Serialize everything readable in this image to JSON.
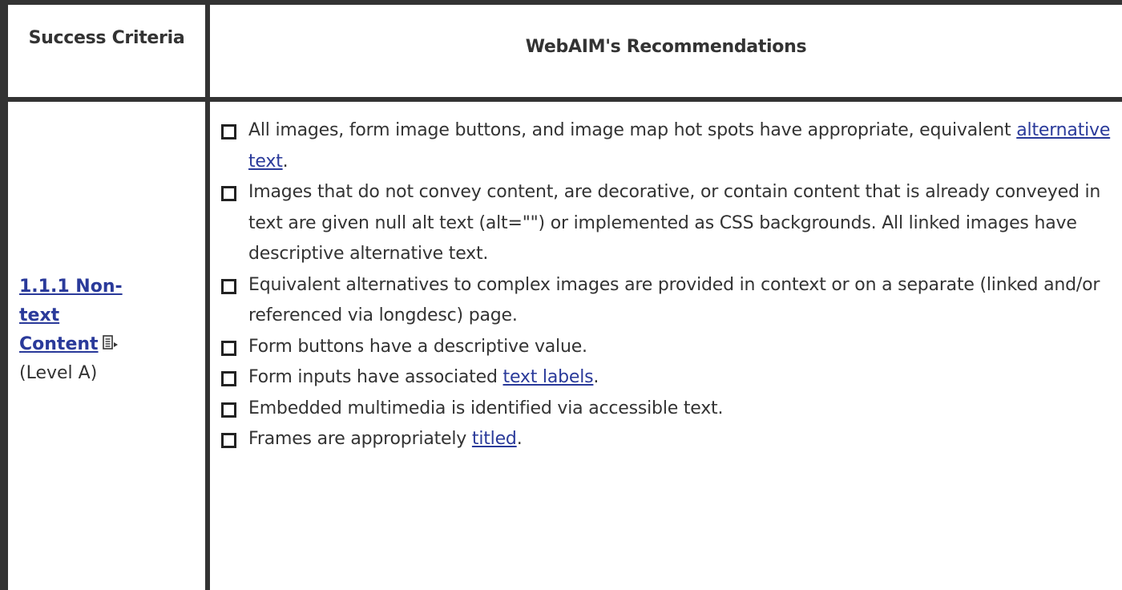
{
  "table": {
    "headers": {
      "criteria": "Success Criteria",
      "recommendations": "WebAIM's Recommendations"
    },
    "criterion": {
      "link_text_1": "1.1.1 Non-",
      "link_text_2": "text",
      "link_text_3": "Content",
      "icon": "document-arrow-icon",
      "level": "(Level A)"
    },
    "items": [
      {
        "before": "All images, form image buttons, and image map hot spots have appropriate, equivalent ",
        "link": "alternative text",
        "after": "."
      },
      {
        "before": "Images that do not convey content, are decorative, or contain content that is already conveyed in text are given null alt text (alt=\"\") or implemented as CSS backgrounds. All linked images have descriptive alternative text.",
        "link": "",
        "after": ""
      },
      {
        "before": "Equivalent alternatives to complex images are provided in context or on a separate (linked and/or referenced via longdesc) page.",
        "link": "",
        "after": ""
      },
      {
        "before": "Form buttons have a descriptive value.",
        "link": "",
        "after": ""
      },
      {
        "before": "Form inputs have associated ",
        "link": "text labels",
        "after": "."
      },
      {
        "before": "Embedded multimedia is identified via accessible text.",
        "link": "",
        "after": ""
      },
      {
        "before": "Frames are appropriately ",
        "link": "titled",
        "after": "."
      }
    ]
  },
  "colors": {
    "border": "#333333",
    "link": "#2a3a9a",
    "text": "#333333"
  }
}
